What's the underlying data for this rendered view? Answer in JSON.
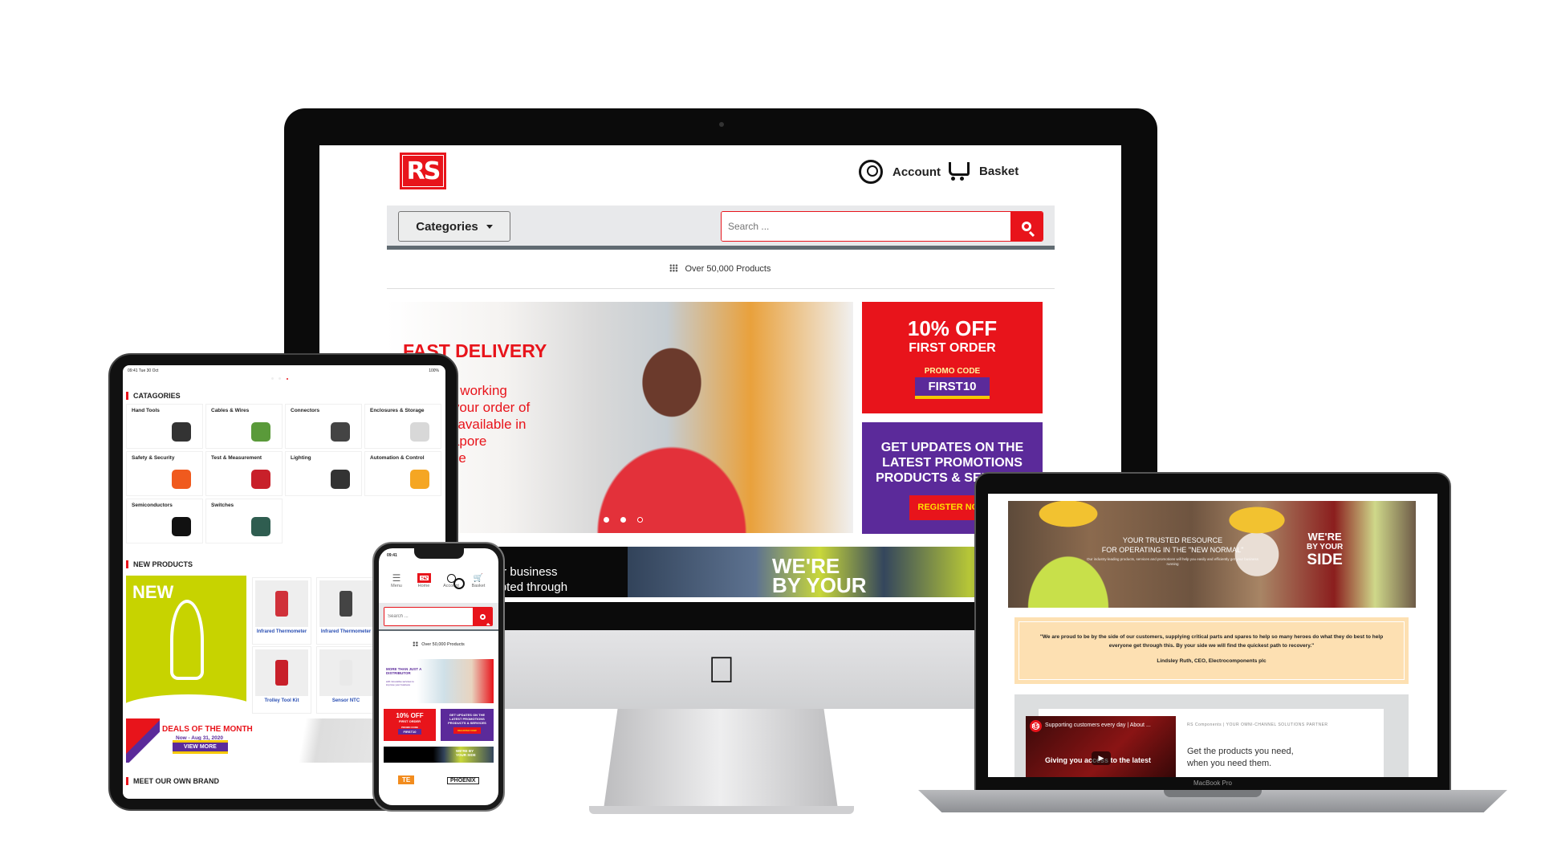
{
  "desktop_site": {
    "logo": "RS",
    "account_label": "Account",
    "basket_label": "Basket",
    "categories_label": "Categories",
    "search_placeholder": "Search ...",
    "products_count": "Over 50,000 Products",
    "hero": {
      "title": "FAST DELIVERY",
      "lines": [
        "3-5 working",
        "or your order of",
        "cts available in",
        "ngapore",
        "ouse"
      ]
    },
    "promo": {
      "headline": "10% OFF",
      "sub": "FIRST ORDER",
      "code_label": "PROMO CODE",
      "code": "FIRST10"
    },
    "updates": {
      "lines": [
        "GET UPDATES ON THE",
        "LATEST PROMOTIONS",
        "PRODUCTS & SERVICES"
      ],
      "button": "REGISTER NOW"
    },
    "band": {
      "lines": [
        "your business",
        "srupted through"
      ],
      "slogan": [
        "WE'RE",
        "BY YOUR"
      ]
    }
  },
  "tablet": {
    "status_time": "09:41  Tue 30 Oct",
    "status_battery": "100%",
    "categories_heading": "CATAGORIES",
    "categories": [
      {
        "label": "Hand Tools",
        "color": "#333333"
      },
      {
        "label": "Cables & Wires",
        "color": "#5a9a3a"
      },
      {
        "label": "Connectors",
        "color": "#444444"
      },
      {
        "label": "Enclosures & Storage",
        "color": "#d8d8d8"
      },
      {
        "label": "Safety & Security",
        "color": "#f05a1e"
      },
      {
        "label": "Test & Measurement",
        "color": "#c8202a"
      },
      {
        "label": "Lighting",
        "color": "#333333"
      },
      {
        "label": "Automation & Control",
        "color": "#f5a623"
      },
      {
        "label": "Semiconductors",
        "color": "#111111"
      },
      {
        "label": "Switches",
        "color": "#2f5d50"
      }
    ],
    "new_products_heading": "NEW PRODUCTS",
    "new_banner": "NEW",
    "products": [
      {
        "name": "Infrared Thermometer"
      },
      {
        "name": "Infrared Thermometer"
      },
      {
        "name": "Trolley Tool Kit"
      },
      {
        "name": "Sensor NTC"
      }
    ],
    "deals": {
      "title": "DEALS OF THE MONTH",
      "dates": "Now - Aug 31, 2020",
      "button": "VIEW MORE"
    },
    "brand_heading": "MEET OUR OWN BRAND"
  },
  "phone": {
    "status_time": "09:41",
    "nav": [
      "Menu",
      "Home",
      "Account",
      "Basket"
    ],
    "search_placeholder": "Search ...",
    "products_count": "Over 50,000 Products",
    "banner": {
      "title": "MORE THAN JUST A DISTRIBUTOR",
      "sub": "with innovative services to improve your business"
    },
    "promo": {
      "headline": "10% OFF",
      "sub": "FIRST ORDER",
      "code_label": "PROMO CODE",
      "code": "FIRST10"
    },
    "updates": {
      "text": "GET UPDATES ON THE LATEST PROMOTIONS PRODUCTS & SERVICES",
      "button": "REGISTER NOW"
    },
    "strip": "WE'RE BY YOUR SIDE",
    "brands": [
      "TE",
      "PHOENIX"
    ]
  },
  "laptop": {
    "banner": {
      "line1": "YOUR TRUSTED RESOURCE",
      "line2": "FOR OPERATING IN THE \"NEW NORMAL\"",
      "sub": "Our industry-leading products, services and promotions will help you easily and efficiently get your business running",
      "slogan": [
        "WE'RE",
        "BY YOUR",
        "SIDE"
      ]
    },
    "quote": "\"We are proud to be by the side of our customers, supplying critical parts and spares to help so many heroes do what they do best to help everyone get through this. By your side we will find the quickest path to recovery.\"",
    "attribution": "Lindsley Ruth, CEO, Electrocomponents plc",
    "video": {
      "title": "Supporting customers every day | About ...",
      "caption": "Giving you access to the latest"
    },
    "kicker": "RS Components | YOUR OMNI-CHANNEL SOLUTIONS PARTNER",
    "tagline": "Get the products you need, when you need them.",
    "model": "MacBook Pro"
  },
  "colors": {
    "brand_red": "#e8141b",
    "brand_purple": "#5b2a9a",
    "accent_yellow": "#f5c800",
    "lime": "#c7d300"
  }
}
